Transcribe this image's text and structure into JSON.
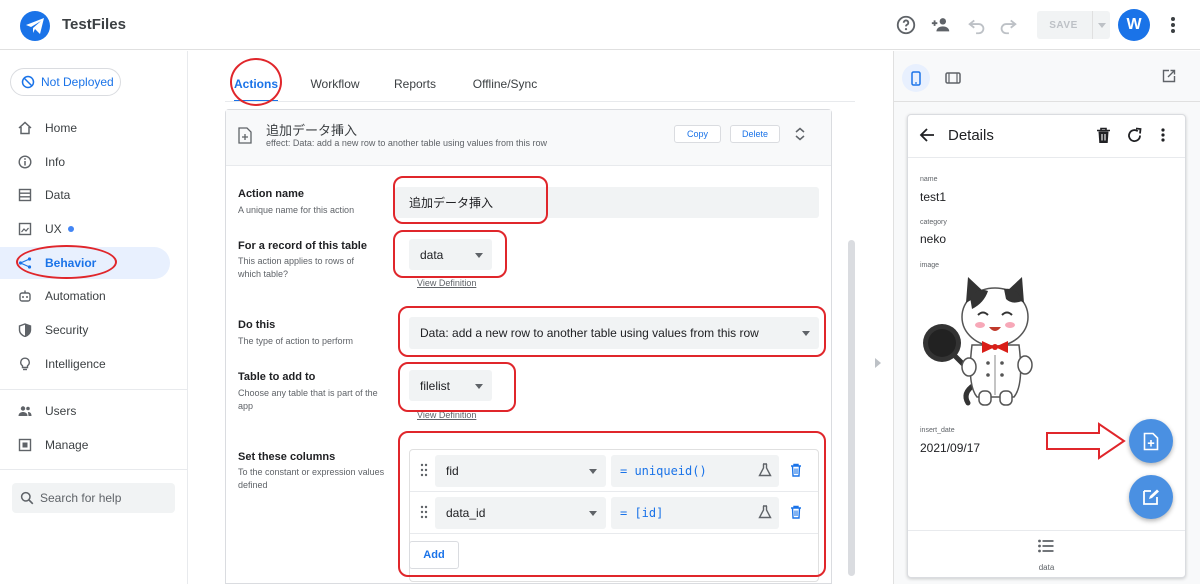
{
  "header": {
    "app_title": "TestFiles",
    "save_label": "SAVE",
    "avatar_initial": "W"
  },
  "sidebar": {
    "deploy_status": "Not Deployed",
    "items": [
      {
        "label": "Home",
        "icon": "home-icon"
      },
      {
        "label": "Info",
        "icon": "info-icon"
      },
      {
        "label": "Data",
        "icon": "database-icon"
      },
      {
        "label": "UX",
        "icon": "ux-icon"
      },
      {
        "label": "Behavior",
        "icon": "behavior-icon"
      },
      {
        "label": "Automation",
        "icon": "robot-icon"
      },
      {
        "label": "Security",
        "icon": "shield-icon"
      },
      {
        "label": "Intelligence",
        "icon": "bulb-icon"
      },
      {
        "label": "Users",
        "icon": "users-icon"
      },
      {
        "label": "Manage",
        "icon": "manage-icon"
      }
    ],
    "active": "Behavior",
    "help_placeholder": "Search for help"
  },
  "tabs": [
    {
      "label": "Actions"
    },
    {
      "label": "Workflow"
    },
    {
      "label": "Reports"
    },
    {
      "label": "Offline/Sync"
    }
  ],
  "action": {
    "title": "追加データ挿入",
    "effect_prefix": "effect:",
    "effect_text": "Data: add a new row to another table using values from this row",
    "copy_label": "Copy",
    "delete_label": "Delete",
    "fields": {
      "name_label": "Action name",
      "name_help": "A unique name for this action",
      "name_value": "追加データ挿入",
      "table_label": "For a record of this table",
      "table_help": "This action applies to rows of which table?",
      "table_value": "data",
      "view_definition": "View Definition",
      "do_label": "Do this",
      "do_help": "The type of action to perform",
      "do_value": "Data: add a new row to another table using values from this row",
      "add_to_label": "Table to add to",
      "add_to_help": "Choose any table that is part of the app",
      "add_to_value": "filelist",
      "columns_label": "Set these columns",
      "columns_help": "To the constant or expression values defined",
      "columns": [
        {
          "column": "fid",
          "expression": "= uniqueid()"
        },
        {
          "column": "data_id",
          "expression": "= [id]"
        }
      ],
      "add_label": "Add"
    }
  },
  "preview": {
    "view_title": "Details",
    "fields": [
      {
        "label": "name",
        "value": "test1"
      },
      {
        "label": "category",
        "value": "neko"
      },
      {
        "label": "image",
        "value": ""
      },
      {
        "label": "insert_date",
        "value": "2021/09/17"
      }
    ],
    "bottom_nav_label": "data"
  },
  "colors": {
    "accent": "#1a73e8",
    "annotation": "#e0262b",
    "fab": "#4a90e2"
  }
}
